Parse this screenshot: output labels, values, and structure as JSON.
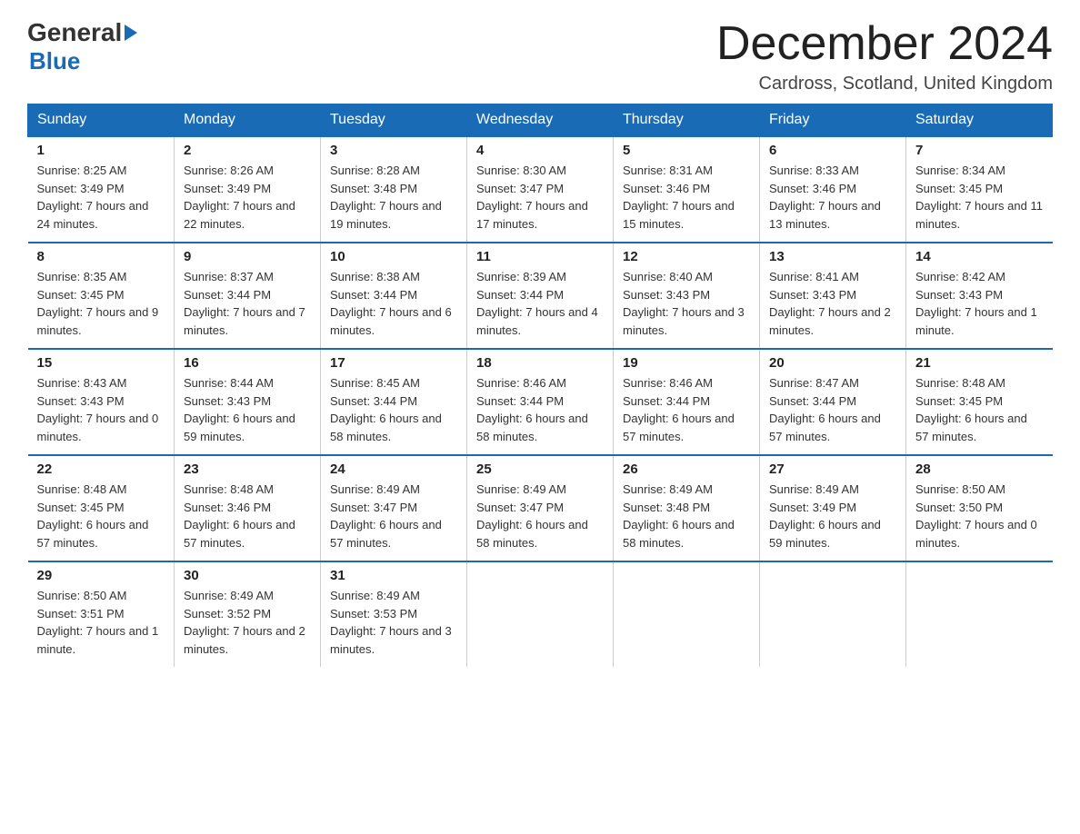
{
  "header": {
    "month_title": "December 2024",
    "location": "Cardross, Scotland, United Kingdom"
  },
  "logo": {
    "general": "General",
    "blue": "Blue"
  },
  "days_of_week": [
    "Sunday",
    "Monday",
    "Tuesday",
    "Wednesday",
    "Thursday",
    "Friday",
    "Saturday"
  ],
  "weeks": [
    [
      {
        "day": "1",
        "sunrise": "Sunrise: 8:25 AM",
        "sunset": "Sunset: 3:49 PM",
        "daylight": "Daylight: 7 hours and 24 minutes."
      },
      {
        "day": "2",
        "sunrise": "Sunrise: 8:26 AM",
        "sunset": "Sunset: 3:49 PM",
        "daylight": "Daylight: 7 hours and 22 minutes."
      },
      {
        "day": "3",
        "sunrise": "Sunrise: 8:28 AM",
        "sunset": "Sunset: 3:48 PM",
        "daylight": "Daylight: 7 hours and 19 minutes."
      },
      {
        "day": "4",
        "sunrise": "Sunrise: 8:30 AM",
        "sunset": "Sunset: 3:47 PM",
        "daylight": "Daylight: 7 hours and 17 minutes."
      },
      {
        "day": "5",
        "sunrise": "Sunrise: 8:31 AM",
        "sunset": "Sunset: 3:46 PM",
        "daylight": "Daylight: 7 hours and 15 minutes."
      },
      {
        "day": "6",
        "sunrise": "Sunrise: 8:33 AM",
        "sunset": "Sunset: 3:46 PM",
        "daylight": "Daylight: 7 hours and 13 minutes."
      },
      {
        "day": "7",
        "sunrise": "Sunrise: 8:34 AM",
        "sunset": "Sunset: 3:45 PM",
        "daylight": "Daylight: 7 hours and 11 minutes."
      }
    ],
    [
      {
        "day": "8",
        "sunrise": "Sunrise: 8:35 AM",
        "sunset": "Sunset: 3:45 PM",
        "daylight": "Daylight: 7 hours and 9 minutes."
      },
      {
        "day": "9",
        "sunrise": "Sunrise: 8:37 AM",
        "sunset": "Sunset: 3:44 PM",
        "daylight": "Daylight: 7 hours and 7 minutes."
      },
      {
        "day": "10",
        "sunrise": "Sunrise: 8:38 AM",
        "sunset": "Sunset: 3:44 PM",
        "daylight": "Daylight: 7 hours and 6 minutes."
      },
      {
        "day": "11",
        "sunrise": "Sunrise: 8:39 AM",
        "sunset": "Sunset: 3:44 PM",
        "daylight": "Daylight: 7 hours and 4 minutes."
      },
      {
        "day": "12",
        "sunrise": "Sunrise: 8:40 AM",
        "sunset": "Sunset: 3:43 PM",
        "daylight": "Daylight: 7 hours and 3 minutes."
      },
      {
        "day": "13",
        "sunrise": "Sunrise: 8:41 AM",
        "sunset": "Sunset: 3:43 PM",
        "daylight": "Daylight: 7 hours and 2 minutes."
      },
      {
        "day": "14",
        "sunrise": "Sunrise: 8:42 AM",
        "sunset": "Sunset: 3:43 PM",
        "daylight": "Daylight: 7 hours and 1 minute."
      }
    ],
    [
      {
        "day": "15",
        "sunrise": "Sunrise: 8:43 AM",
        "sunset": "Sunset: 3:43 PM",
        "daylight": "Daylight: 7 hours and 0 minutes."
      },
      {
        "day": "16",
        "sunrise": "Sunrise: 8:44 AM",
        "sunset": "Sunset: 3:43 PM",
        "daylight": "Daylight: 6 hours and 59 minutes."
      },
      {
        "day": "17",
        "sunrise": "Sunrise: 8:45 AM",
        "sunset": "Sunset: 3:44 PM",
        "daylight": "Daylight: 6 hours and 58 minutes."
      },
      {
        "day": "18",
        "sunrise": "Sunrise: 8:46 AM",
        "sunset": "Sunset: 3:44 PM",
        "daylight": "Daylight: 6 hours and 58 minutes."
      },
      {
        "day": "19",
        "sunrise": "Sunrise: 8:46 AM",
        "sunset": "Sunset: 3:44 PM",
        "daylight": "Daylight: 6 hours and 57 minutes."
      },
      {
        "day": "20",
        "sunrise": "Sunrise: 8:47 AM",
        "sunset": "Sunset: 3:44 PM",
        "daylight": "Daylight: 6 hours and 57 minutes."
      },
      {
        "day": "21",
        "sunrise": "Sunrise: 8:48 AM",
        "sunset": "Sunset: 3:45 PM",
        "daylight": "Daylight: 6 hours and 57 minutes."
      }
    ],
    [
      {
        "day": "22",
        "sunrise": "Sunrise: 8:48 AM",
        "sunset": "Sunset: 3:45 PM",
        "daylight": "Daylight: 6 hours and 57 minutes."
      },
      {
        "day": "23",
        "sunrise": "Sunrise: 8:48 AM",
        "sunset": "Sunset: 3:46 PM",
        "daylight": "Daylight: 6 hours and 57 minutes."
      },
      {
        "day": "24",
        "sunrise": "Sunrise: 8:49 AM",
        "sunset": "Sunset: 3:47 PM",
        "daylight": "Daylight: 6 hours and 57 minutes."
      },
      {
        "day": "25",
        "sunrise": "Sunrise: 8:49 AM",
        "sunset": "Sunset: 3:47 PM",
        "daylight": "Daylight: 6 hours and 58 minutes."
      },
      {
        "day": "26",
        "sunrise": "Sunrise: 8:49 AM",
        "sunset": "Sunset: 3:48 PM",
        "daylight": "Daylight: 6 hours and 58 minutes."
      },
      {
        "day": "27",
        "sunrise": "Sunrise: 8:49 AM",
        "sunset": "Sunset: 3:49 PM",
        "daylight": "Daylight: 6 hours and 59 minutes."
      },
      {
        "day": "28",
        "sunrise": "Sunrise: 8:50 AM",
        "sunset": "Sunset: 3:50 PM",
        "daylight": "Daylight: 7 hours and 0 minutes."
      }
    ],
    [
      {
        "day": "29",
        "sunrise": "Sunrise: 8:50 AM",
        "sunset": "Sunset: 3:51 PM",
        "daylight": "Daylight: 7 hours and 1 minute."
      },
      {
        "day": "30",
        "sunrise": "Sunrise: 8:49 AM",
        "sunset": "Sunset: 3:52 PM",
        "daylight": "Daylight: 7 hours and 2 minutes."
      },
      {
        "day": "31",
        "sunrise": "Sunrise: 8:49 AM",
        "sunset": "Sunset: 3:53 PM",
        "daylight": "Daylight: 7 hours and 3 minutes."
      },
      null,
      null,
      null,
      null
    ]
  ]
}
